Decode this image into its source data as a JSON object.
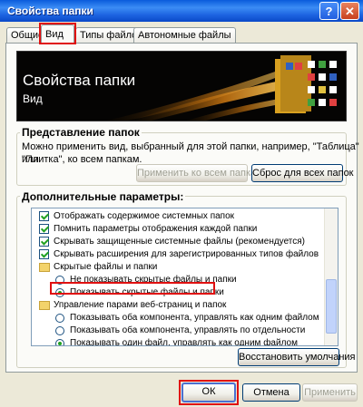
{
  "window": {
    "title": "Свойства папки",
    "help_label": "?",
    "close_label": "✕"
  },
  "tabs": [
    "Общие",
    "Вид",
    "Типы файлов",
    "Автономные файлы"
  ],
  "banner": {
    "title": "Свойства папки",
    "subtitle": "Вид"
  },
  "folder_view": {
    "title": "Представление папок",
    "description_line1": "Можно применить вид, выбранный для этой папки, например, \"Таблица\" или",
    "description_line2": "\"Плитка\", ко всем папкам.",
    "apply_all_label": "Применить ко всем папкам",
    "reset_all_label": "Сброс для всех папок"
  },
  "advanced": {
    "title": "Дополнительные параметры:",
    "items": [
      {
        "type": "checkbox",
        "checked": true,
        "label": "Отображать содержимое системных папок"
      },
      {
        "type": "checkbox",
        "checked": true,
        "label": "Помнить параметры отображения каждой папки"
      },
      {
        "type": "checkbox",
        "checked": true,
        "label": "Скрывать защищенные системные файлы (рекомендуется)"
      },
      {
        "type": "checkbox",
        "checked": true,
        "label": "Скрывать расширения для зарегистрированных типов файлов"
      },
      {
        "type": "folder",
        "label": "Скрытые файлы и папки"
      },
      {
        "type": "radio",
        "checked": false,
        "label": "Не показывать скрытые файлы и папки"
      },
      {
        "type": "radio",
        "checked": true,
        "label": "Показывать скрытые файлы и папки"
      },
      {
        "type": "folder",
        "label": "Управление парами веб-страниц и папок"
      },
      {
        "type": "radio",
        "checked": false,
        "label": "Показывать оба компонента, управлять как одним файлом"
      },
      {
        "type": "radio",
        "checked": false,
        "label": "Показывать оба компонента, управлять по отдельности"
      },
      {
        "type": "radio",
        "checked": true,
        "label": "Показывать один файл, управлять как одним файлом"
      }
    ],
    "restore_label": "Восстановить умолчания"
  },
  "footer": {
    "ok_label": "ОК",
    "cancel_label": "Отмена",
    "apply_label": "Применить"
  },
  "colors": {
    "highlight": "#e01010",
    "titlebar": "#0a5bdc",
    "dialog_bg": "#ece9d8"
  }
}
